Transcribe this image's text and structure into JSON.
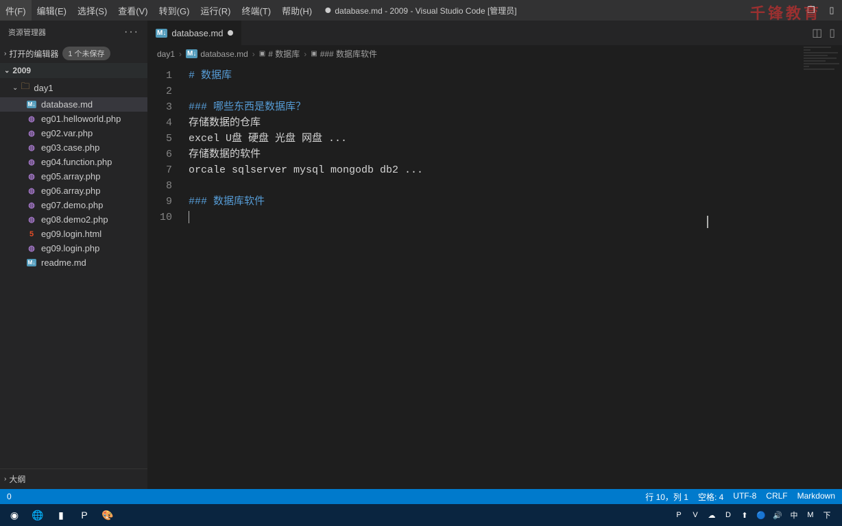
{
  "menubar": {
    "items": [
      "件(F)",
      "编辑(E)",
      "选择(S)",
      "查看(V)",
      "转到(G)",
      "运行(R)",
      "终端(T)",
      "帮助(H)"
    ],
    "title": "database.md - 2009 - Visual Studio Code [管理员]"
  },
  "watermark": "千锋教育",
  "explorer": {
    "title": "资源管理器",
    "open_editors": "打开的编辑器",
    "unsaved_badge": "1 个未保存",
    "workspace": "2009",
    "folder": "day1",
    "files": [
      {
        "name": "database.md",
        "type": "md",
        "active": true
      },
      {
        "name": "eg01.helloworld.php",
        "type": "php"
      },
      {
        "name": "eg02.var.php",
        "type": "php"
      },
      {
        "name": "eg03.case.php",
        "type": "php"
      },
      {
        "name": "eg04.function.php",
        "type": "php"
      },
      {
        "name": "eg05.array.php",
        "type": "php"
      },
      {
        "name": "eg06.array.php",
        "type": "php"
      },
      {
        "name": "eg07.demo.php",
        "type": "php"
      },
      {
        "name": "eg08.demo2.php",
        "type": "php"
      },
      {
        "name": "eg09.login.html",
        "type": "html"
      },
      {
        "name": "eg09.login.php",
        "type": "php"
      },
      {
        "name": "readme.md",
        "type": "md"
      }
    ],
    "outline": "大纲"
  },
  "tab": {
    "label": "database.md"
  },
  "breadcrumb": {
    "parts": [
      "day1",
      "database.md",
      "# 数据库",
      "### 数据库软件"
    ]
  },
  "code": {
    "lines": [
      {
        "n": 1,
        "type": "h1",
        "mark": "# ",
        "text": "数据库"
      },
      {
        "n": 2,
        "type": "blank",
        "text": ""
      },
      {
        "n": 3,
        "type": "h3",
        "mark": "### ",
        "text": "哪些东西是数据库？"
      },
      {
        "n": 4,
        "type": "plain",
        "text": "存储数据的仓库"
      },
      {
        "n": 5,
        "type": "plain",
        "text": "excel U盘 硬盘 光盘 网盘 ..."
      },
      {
        "n": 6,
        "type": "plain",
        "text": "存储数据的软件"
      },
      {
        "n": 7,
        "type": "plain",
        "text": "orcale sqlserver mysql mongodb db2 ..."
      },
      {
        "n": 8,
        "type": "blank",
        "text": ""
      },
      {
        "n": 9,
        "type": "h3",
        "mark": "### ",
        "text": "数据库软件"
      },
      {
        "n": 10,
        "type": "cursor",
        "text": ""
      }
    ]
  },
  "statusbar": {
    "left": [
      "0"
    ],
    "right": [
      "行 10，列 1",
      "空格: 4",
      "UTF-8",
      "CRLF",
      "Markdown"
    ]
  },
  "taskbar": {
    "items": [
      "◉",
      "🌐",
      "▮",
      "P",
      "🎨"
    ],
    "tray": [
      "P",
      "V",
      "☁",
      "D",
      "⬆",
      "🔵",
      "🔊",
      "中",
      "M",
      "下"
    ]
  }
}
